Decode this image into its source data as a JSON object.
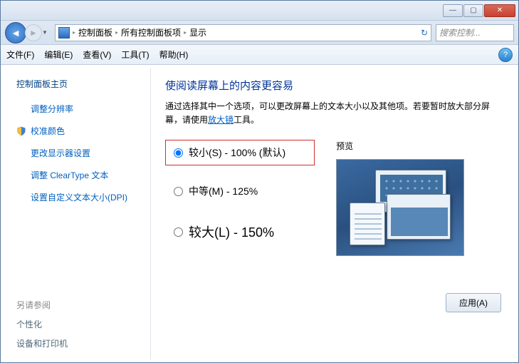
{
  "titlebar": {
    "min": "—",
    "max": "▢",
    "close": "✕"
  },
  "nav": {
    "crumbs": [
      "控制面板",
      "所有控制面板项",
      "显示"
    ],
    "search_placeholder": "搜索控制..."
  },
  "menu": {
    "file": "文件(F)",
    "edit": "编辑(E)",
    "view": "查看(V)",
    "tools": "工具(T)",
    "help": "帮助(H)"
  },
  "sidebar": {
    "home": "控制面板主页",
    "links": [
      "调整分辨率",
      "校准颜色",
      "更改显示器设置",
      "调整 ClearType 文本",
      "设置自定义文本大小(DPI)"
    ],
    "seealso": "另请参阅",
    "sa_links": [
      "个性化",
      "设备和打印机"
    ]
  },
  "main": {
    "title": "使阅读屏幕上的内容更容易",
    "desc_a": "通过选择其中一个选项，可以更改屏幕上的文本大小以及其他项。若要暂时放大部分屏幕，请使用",
    "desc_link": "放大镜",
    "desc_b": "工具。",
    "options": [
      {
        "label": "较小(S) - 100% (默认)",
        "value": "small",
        "checked": true
      },
      {
        "label": "中等(M) - 125%",
        "value": "medium",
        "checked": false
      },
      {
        "label": "较大(L) - 150%",
        "value": "large",
        "checked": false
      }
    ],
    "preview_label": "预览",
    "apply": "应用(A)"
  }
}
